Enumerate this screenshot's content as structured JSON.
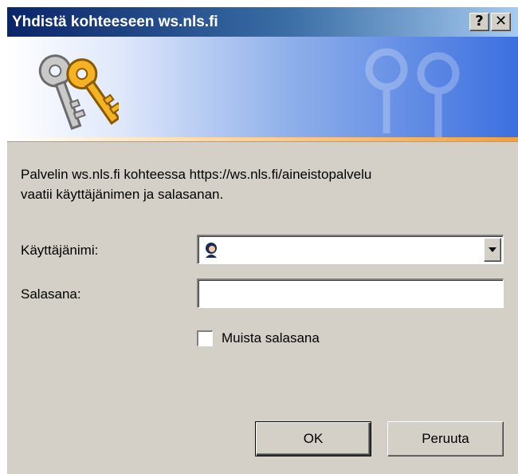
{
  "window": {
    "title": "Yhdistä kohteeseen ws.nls.fi",
    "help_button": "?",
    "close_button": "✕"
  },
  "banner": {
    "icon": "keys-icon"
  },
  "message": {
    "line1": "Palvelin ws.nls.fi kohteessa https://ws.nls.fi/aineistopalvelu",
    "line2": "vaatii käyttäjänimen ja salasanan."
  },
  "username": {
    "label": "Käyttäjänimi:",
    "value": "",
    "icon": "user-icon"
  },
  "password": {
    "label": "Salasana:",
    "value": ""
  },
  "remember": {
    "label": "Muista salasana",
    "checked": false
  },
  "buttons": {
    "ok": "OK",
    "cancel": "Peruuta"
  },
  "colors": {
    "titlebar_start": "#0a246a",
    "face": "#d4d0c8"
  }
}
